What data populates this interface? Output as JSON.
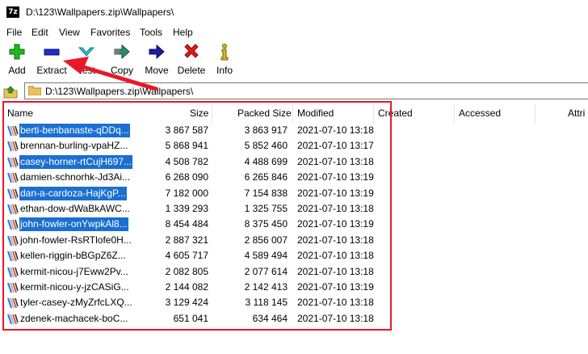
{
  "window": {
    "title": "D:\\123\\Wallpapers.zip\\Wallpapers\\",
    "app_icon": "7z"
  },
  "menu": [
    "File",
    "Edit",
    "View",
    "Favorites",
    "Tools",
    "Help"
  ],
  "toolbar": [
    {
      "label": "Add",
      "icon": "plus-icon",
      "color": "#1db81d"
    },
    {
      "label": "Extract",
      "icon": "minus-icon",
      "color": "#1b2ec8"
    },
    {
      "label": "Test",
      "icon": "check-icon",
      "color": "#2bc4d8"
    },
    {
      "label": "Copy",
      "icon": "copy-arrow-icon",
      "color": "#2a8a6e"
    },
    {
      "label": "Move",
      "icon": "move-arrow-icon",
      "color": "#1c1c9a"
    },
    {
      "label": "Delete",
      "icon": "x-icon",
      "color": "#e01a1a"
    },
    {
      "label": "Info",
      "icon": "info-icon",
      "color": "#d8b21c"
    }
  ],
  "address": {
    "path": "D:\\123\\Wallpapers.zip\\Wallpapers\\"
  },
  "columns": {
    "name": "Name",
    "size": "Size",
    "packed": "Packed Size",
    "modified": "Modified",
    "created": "Created",
    "accessed": "Accessed",
    "attributes": "Attri"
  },
  "files": [
    {
      "name": "berti-benbanaste-qDDq...",
      "size": "3 867 587",
      "packed": "3 863 917",
      "modified": "2021-07-10 13:18",
      "selected": true
    },
    {
      "name": "brennan-burling-vpaHZ...",
      "size": "5 868 941",
      "packed": "5 852 460",
      "modified": "2021-07-10 13:17",
      "selected": false
    },
    {
      "name": "casey-horner-rtCujH697...",
      "size": "4 508 782",
      "packed": "4 488 699",
      "modified": "2021-07-10 13:18",
      "selected": true
    },
    {
      "name": "damien-schnorhk-Jd3Ai...",
      "size": "6 268 090",
      "packed": "6 265 846",
      "modified": "2021-07-10 13:19",
      "selected": false
    },
    {
      "name": "dan-a-cardoza-HajKgP...",
      "size": "7 182 000",
      "packed": "7 154 838",
      "modified": "2021-07-10 13:19",
      "selected": true
    },
    {
      "name": "ethan-dow-dWaBkAWC...",
      "size": "1 339 293",
      "packed": "1 325 755",
      "modified": "2021-07-10 13:18",
      "selected": false
    },
    {
      "name": "john-fowler-onYwpkAl8...",
      "size": "8 454 484",
      "packed": "8 375 450",
      "modified": "2021-07-10 13:19",
      "selected": true
    },
    {
      "name": "john-fowler-RsRTlofe0H...",
      "size": "2 887 321",
      "packed": "2 856 007",
      "modified": "2021-07-10 13:18",
      "selected": false
    },
    {
      "name": "kellen-riggin-bBGpZ6Z...",
      "size": "4 605 717",
      "packed": "4 589 494",
      "modified": "2021-07-10 13:18",
      "selected": false
    },
    {
      "name": "kermit-nicou-j7Eww2Pv...",
      "size": "2 082 805",
      "packed": "2 077 614",
      "modified": "2021-07-10 13:18",
      "selected": false
    },
    {
      "name": "kermit-nicou-y-jzCASiG...",
      "size": "2 144 082",
      "packed": "2 142 413",
      "modified": "2021-07-10 13:19",
      "selected": false
    },
    {
      "name": "tyler-casey-zMyZrfcLXQ...",
      "size": "3 129 424",
      "packed": "3 118 145",
      "modified": "2021-07-10 13:18",
      "selected": false
    },
    {
      "name": "zdenek-machacek-boC...",
      "size": "651 041",
      "packed": "634 464",
      "modified": "2021-07-10 13:18",
      "selected": false
    }
  ],
  "annotation": {
    "box_color": "#e8182a",
    "arrow_color": "#e8182a"
  }
}
